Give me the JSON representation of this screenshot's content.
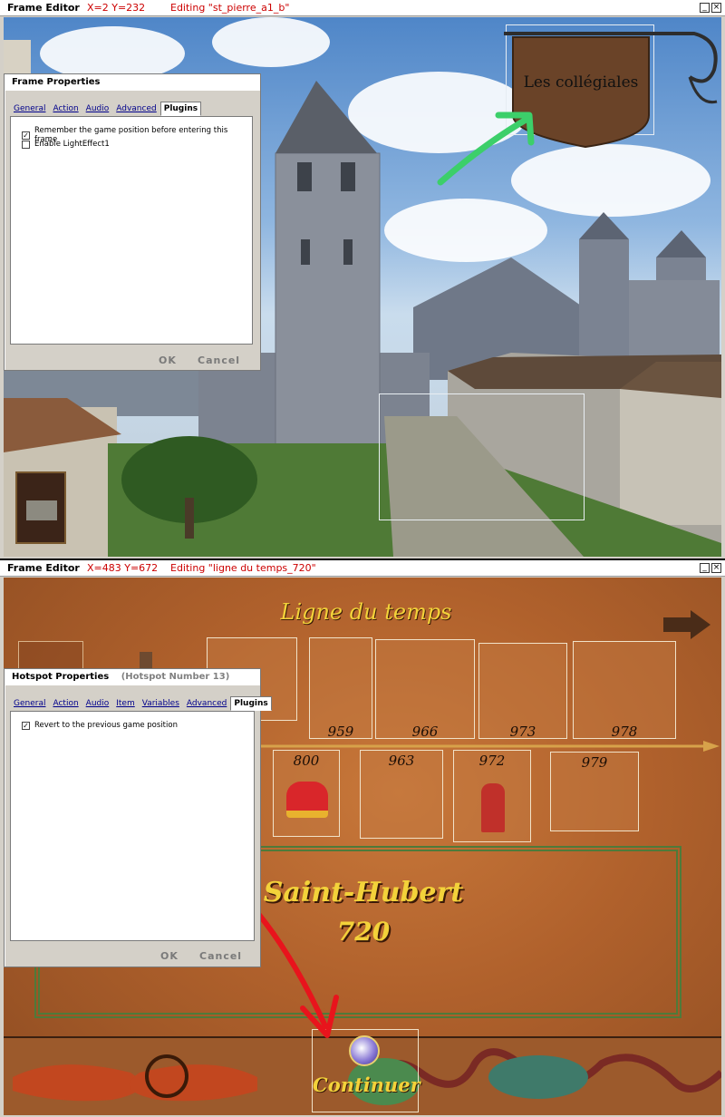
{
  "editor_top": {
    "title": "Frame Editor",
    "coords": "X=2 Y=232",
    "editing": "Editing \"st_pierre_a1_b\"",
    "scene": {
      "sign_text": "Les collégiales"
    },
    "dialog": {
      "title": "Frame Properties",
      "tabs": [
        "General",
        "Action",
        "Audio",
        "Advanced",
        "Plugins"
      ],
      "active_tab": "Plugins",
      "options": [
        {
          "label": "Remember the game position before entering this frame",
          "checked": true,
          "mark": "✓"
        },
        {
          "label": "Enable LightEffect1",
          "checked": false,
          "mark": ""
        }
      ],
      "ok_label": "OK",
      "cancel_label": "Cancel"
    }
  },
  "editor_bottom": {
    "title": "Frame Editor",
    "coords": "X=483 Y=672",
    "editing": "Editing \"ligne du temps_720\"",
    "scene": {
      "heading": "Ligne du temps",
      "top_row_years": [
        "959",
        "966",
        "973",
        "978"
      ],
      "bottom_row_years": [
        "800",
        "963",
        "972",
        "979"
      ],
      "place_name": "Saint-Hubert",
      "place_year": "720",
      "continue_label": "Continuer"
    },
    "dialog": {
      "title": "Hotspot Properties",
      "subtitle": "(Hotspot Number 13)",
      "tabs": [
        "General",
        "Action",
        "Audio",
        "Item",
        "Variables",
        "Advanced",
        "Plugins"
      ],
      "active_tab": "Plugins",
      "options": [
        {
          "label": "Revert to the previous game position",
          "checked": true,
          "mark": "✓"
        }
      ],
      "ok_label": "OK",
      "cancel_label": "Cancel"
    }
  },
  "colors": {
    "title_red": "#cc0000",
    "annotation_green": "#3ccf6a",
    "annotation_red": "#e8141c",
    "gold_text": "#f3d23a"
  }
}
